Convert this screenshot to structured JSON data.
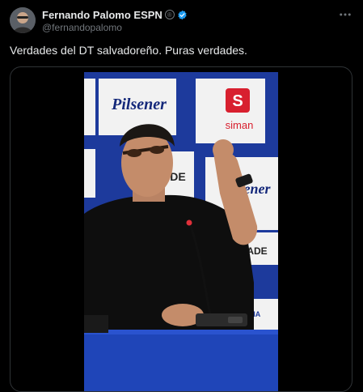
{
  "author": {
    "display_name": "Fernando Palomo ESPN",
    "registered_mark": "®",
    "handle": "@fernandopalomo",
    "verified_color": "#1d9bf0"
  },
  "post": {
    "text": "Verdades del DT salvadoreño. Puras verdades."
  },
  "media": {
    "type": "video",
    "backdrop_texts": [
      "Pilsener",
      "S",
      "siman",
      "DE",
      "Pilsener",
      "WERADE",
      "RMA"
    ]
  },
  "icons": {
    "more": "more-horizontal-icon",
    "verified": "verified-badge-icon"
  },
  "colors": {
    "background": "#000000",
    "primary_text": "#e7e9ea",
    "secondary_text": "#71767b",
    "border": "#2f3336",
    "brand_red": "#c8102e",
    "backdrop_blue": "#1d3a9c"
  }
}
